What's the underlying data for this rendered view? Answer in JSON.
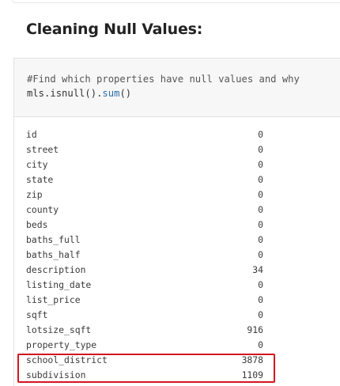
{
  "heading": "Cleaning Null Values:",
  "code": {
    "comment": "#Find which properties have null values and why",
    "object": "mls",
    "func1": "isnull",
    "func2": "sum",
    "dot": ".",
    "call": "()"
  },
  "output": {
    "rows": [
      {
        "key": "id",
        "value": "0"
      },
      {
        "key": "street",
        "value": "0"
      },
      {
        "key": "city",
        "value": "0"
      },
      {
        "key": "state",
        "value": "0"
      },
      {
        "key": "zip",
        "value": "0"
      },
      {
        "key": "county",
        "value": "0"
      },
      {
        "key": "beds",
        "value": "0"
      },
      {
        "key": "baths_full",
        "value": "0"
      },
      {
        "key": "baths_half",
        "value": "0"
      },
      {
        "key": "description",
        "value": "34"
      },
      {
        "key": "listing_date",
        "value": "0"
      },
      {
        "key": "list_price",
        "value": "0"
      },
      {
        "key": "sqft",
        "value": "0"
      },
      {
        "key": "lotsize_sqft",
        "value": "916"
      },
      {
        "key": "property_type",
        "value": "0"
      },
      {
        "key": "school_district",
        "value": "3878"
      },
      {
        "key": "subdivision",
        "value": "1109"
      }
    ]
  },
  "colors": {
    "highlight": "#d2161e",
    "code_background": "#f7f7f7",
    "function_token": "#2a6fa8"
  }
}
